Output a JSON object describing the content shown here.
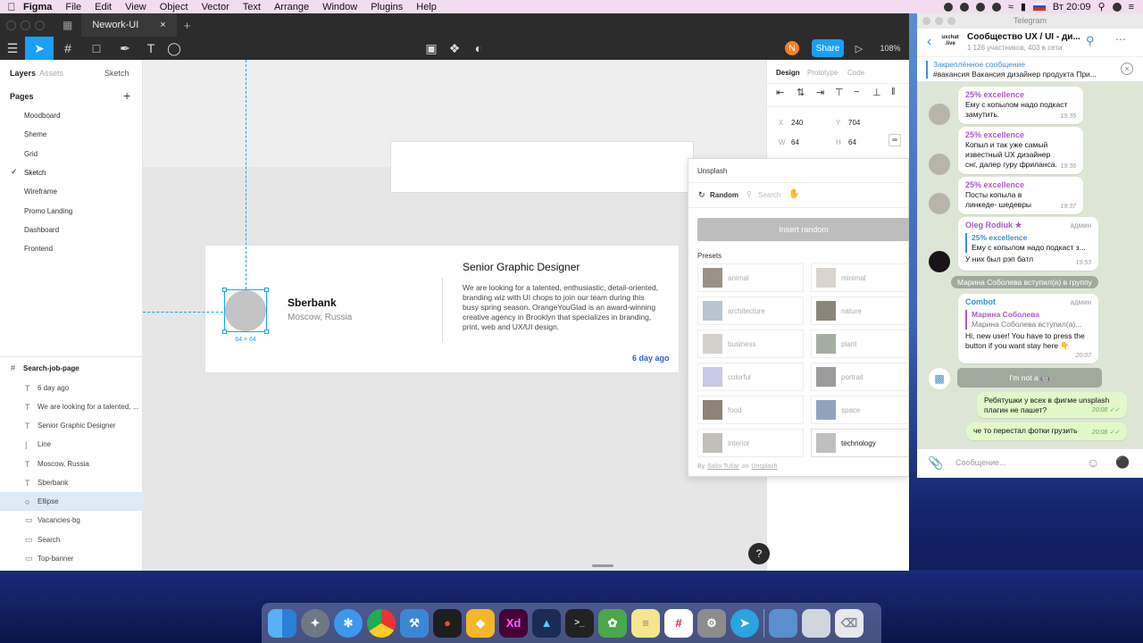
{
  "menubar": {
    "app": "Figma",
    "items": [
      "File",
      "Edit",
      "View",
      "Object",
      "Vector",
      "Text",
      "Arrange",
      "Window",
      "Plugins",
      "Help"
    ],
    "clock": "Вт 20:09"
  },
  "figma": {
    "tab_name": "Nework-UI",
    "user_initial": "N",
    "share_label": "Share",
    "zoom": "108%",
    "layers_panel": {
      "tab_layers": "Layers",
      "tab_assets": "Assets",
      "page_selector": "Sketch",
      "pages_heading": "Pages",
      "pages": [
        "Moodboard",
        "Sheme",
        "Grid",
        "Sketch",
        "Wireframe",
        "Promo Landing",
        "Dashboard",
        "Frontend"
      ],
      "frame_name": "Search-job-page",
      "layers": [
        {
          "icon": "T",
          "name": "6 day ago"
        },
        {
          "icon": "T",
          "name": "We are looking for a talented, ..."
        },
        {
          "icon": "T",
          "name": "Senior Graphic Designer"
        },
        {
          "icon": "|",
          "name": "Line"
        },
        {
          "icon": "T",
          "name": "Moscow, Russia"
        },
        {
          "icon": "T",
          "name": "Sberbank"
        },
        {
          "icon": "○",
          "name": "Ellipse"
        },
        {
          "icon": "▭",
          "name": "Vacancies-bg"
        },
        {
          "icon": "▭",
          "name": "Search"
        },
        {
          "icon": "▭",
          "name": "Top-banner"
        }
      ]
    },
    "canvas": {
      "company": "Sberbank",
      "location": "Moscow, Russia",
      "job_title": "Senior Graphic Designer",
      "job_description": "We are looking for a talented, enthusiastic, detail-oriented, branding wiz with UI chops to join our team during this busy spring season. OrangeYouGlad is an award-winning creative agency in Brooklyn that specializes in branding, print, web and UX/UI design.",
      "posted": "6 day ago",
      "selection_size": "64 × 64"
    },
    "design_panel": {
      "tab_design": "Design",
      "tab_prototype": "Prototype",
      "tab_code": "Code",
      "x_label": "X",
      "x_value": "240",
      "y_label": "Y",
      "y_value": "704",
      "w_label": "W",
      "w_value": "64",
      "h_label": "H",
      "h_value": "64"
    },
    "unsplash": {
      "title": "Unsplash",
      "random_label": "Random",
      "search_placeholder": "Search",
      "insert_button": "Insert random",
      "presets_heading": "Presets",
      "presets": [
        "animal",
        "minimal",
        "architecture",
        "nature",
        "business",
        "plant",
        "colorful",
        "portrait",
        "food",
        "space",
        "interior",
        "technology"
      ],
      "credit_by": "By",
      "credit_author": "Sašo Tušar",
      "credit_on": "on",
      "credit_site": "Unsplash"
    }
  },
  "telegram": {
    "window_title": "Telegram",
    "channel_logo": "uxchat .live",
    "chat_title": "Сообщество UX / UI - ди...",
    "chat_subtitle": "1 126 участников, 403 в сети",
    "pinned_label": "Закреплённое сообщение",
    "pinned_text": "#вакансия Вакансия дизайнер продукта  При...",
    "messages": [
      {
        "name": "25% excellence",
        "text": "Ему с копылом надо подкаст замутить.",
        "time": "19:35"
      },
      {
        "name": "25% excellence",
        "text": "Копыл и так уже самый известный UX дизайнер снг, далер гуру фриланса.",
        "time": "19:36"
      },
      {
        "name": "25% excellence",
        "text": "Посты копыла в линкеде- шедевры",
        "time": "19:37"
      }
    ],
    "reply_msg": {
      "name": "Oleg Rodiuk ★",
      "role": "админ",
      "quote_name": "25% excellence",
      "quote_text": "Ему с копылом надо подкаст з...",
      "text": "У них был рэп батл",
      "time": "19:53"
    },
    "system_join": "Марина Соболева вступил(а) в группу",
    "bot_msg": {
      "name": "Combot",
      "role": "админ",
      "quote_name": "Марина Соболева",
      "quote_text": "Марина Соболева вступил(а)...",
      "text": "Hi, new user! You have to press the button if you want stay here 👇",
      "time": "20:07"
    },
    "bot_button": "I'm not a 🤖",
    "outgoing": [
      {
        "text": "Ребятушки у всех в фигме unsplash плагин не пашет?",
        "time": "20:08 ✓✓"
      },
      {
        "text": "че то перестал фотки грузить",
        "time": "20:08 ✓✓"
      }
    ],
    "input_placeholder": "Сообщение..."
  },
  "dock": {
    "xd_label": "Xd"
  }
}
